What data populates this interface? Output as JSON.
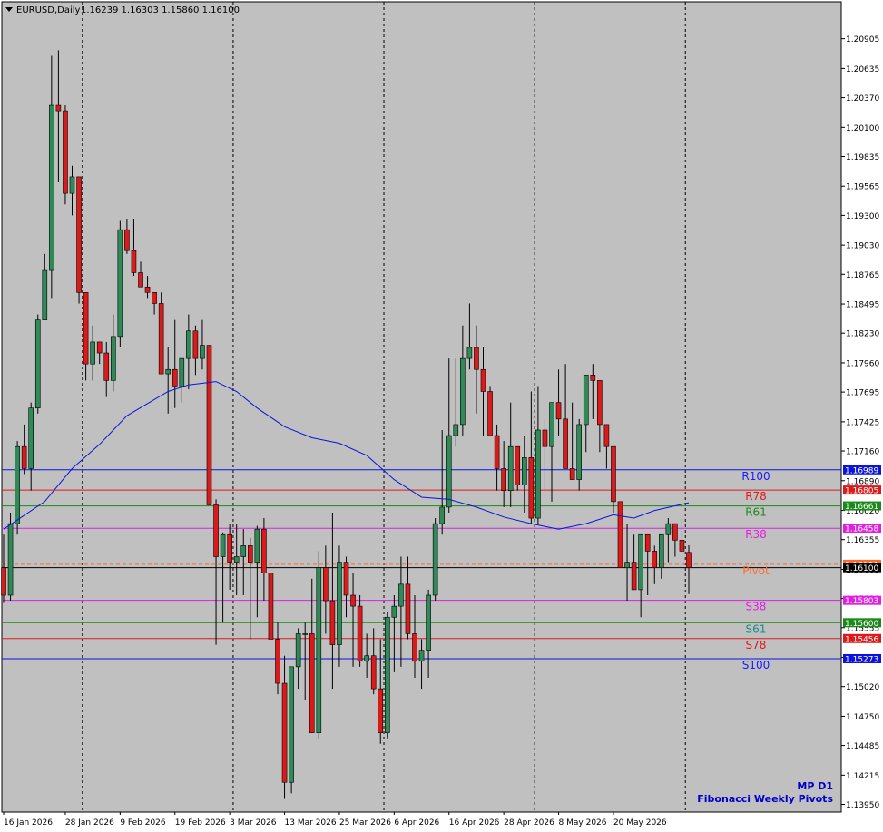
{
  "header": {
    "symbol": "EURUSD,Daily",
    "ohlc": "1.16239 1.16303 1.15860 1.16100",
    "menu_icon": "triangle-down-icon"
  },
  "branding": {
    "line1": "MP D1",
    "line2": "Fibonacci Weekly Pivots"
  },
  "colors": {
    "plot_bg": "#c0c0c0",
    "bull_body": "#2e8b57",
    "bear_body": "#dc1a1a",
    "wick": "#000000",
    "ma_line": "#0a14dc",
    "brand": "#0000cc",
    "current_price": "#ff6a2a"
  },
  "chart_data": {
    "type": "candlestick",
    "title": "EURUSD,Daily",
    "ylim": [
      1.1388,
      1.2124
    ],
    "y_ticks": [
      "1.20905",
      "1.20635",
      "1.20370",
      "1.20100",
      "1.19835",
      "1.19565",
      "1.19300",
      "1.19030",
      "1.18765",
      "1.18495",
      "1.18230",
      "1.17960",
      "1.17695",
      "1.17425",
      "1.17160",
      "1.16890",
      "1.16620",
      "1.16355",
      "1.16085",
      "1.15820",
      "1.15555",
      "1.15285",
      "1.15020",
      "1.14750",
      "1.14485",
      "1.14215",
      "1.13950"
    ],
    "x_labels": [
      {
        "label": "16 Jan 2026",
        "i": 0
      },
      {
        "label": "28 Jan 2026",
        "i": 9
      },
      {
        "label": "9 Feb 2026",
        "i": 17
      },
      {
        "label": "19 Feb 2026",
        "i": 25
      },
      {
        "label": "3 Mar 2026",
        "i": 33
      },
      {
        "label": "13 Mar 2026",
        "i": 41
      },
      {
        "label": "25 Mar 2026",
        "i": 49
      },
      {
        "label": "6 Apr 2026",
        "i": 57
      },
      {
        "label": "16 Apr 2026",
        "i": 65
      },
      {
        "label": "28 Apr 2026",
        "i": 73
      },
      {
        "label": "8 May 2026",
        "i": 81
      },
      {
        "label": "20 May 2026",
        "i": 89
      }
    ],
    "period_separators": [
      11.5,
      33.5,
      55.5,
      77.5,
      99.5
    ],
    "candles": [
      [
        1.161,
        1.164,
        1.1578,
        1.1585
      ],
      [
        1.1585,
        1.166,
        1.158,
        1.165
      ],
      [
        1.165,
        1.1725,
        1.164,
        1.172
      ],
      [
        1.172,
        1.174,
        1.1695,
        1.17
      ],
      [
        1.17,
        1.176,
        1.168,
        1.1755
      ],
      [
        1.1755,
        1.184,
        1.175,
        1.1835
      ],
      [
        1.1835,
        1.1895,
        1.187,
        1.188
      ],
      [
        1.188,
        1.2075,
        1.1855,
        1.203
      ],
      [
        1.203,
        1.208,
        1.196,
        1.2025
      ],
      [
        1.2025,
        1.203,
        1.194,
        1.195
      ],
      [
        1.195,
        1.1975,
        1.193,
        1.1965
      ],
      [
        1.1965,
        1.1965,
        1.185,
        1.186
      ],
      [
        1.186,
        1.186,
        1.178,
        1.1795
      ],
      [
        1.1795,
        1.183,
        1.178,
        1.1815
      ],
      [
        1.1815,
        1.1815,
        1.1795,
        1.1805
      ],
      [
        1.1805,
        1.1815,
        1.1765,
        1.178
      ],
      [
        1.178,
        1.184,
        1.177,
        1.182
      ],
      [
        1.182,
        1.1925,
        1.181,
        1.1917
      ],
      [
        1.1917,
        1.1927,
        1.1895,
        1.1898
      ],
      [
        1.1898,
        1.1927,
        1.1875,
        1.1878
      ],
      [
        1.1878,
        1.1888,
        1.1868,
        1.1865
      ],
      [
        1.1865,
        1.1875,
        1.1855,
        1.186
      ],
      [
        1.186,
        1.186,
        1.184,
        1.185
      ],
      [
        1.185,
        1.186,
        1.179,
        1.1786
      ],
      [
        1.1786,
        1.181,
        1.175,
        1.179
      ],
      [
        1.179,
        1.1835,
        1.1755,
        1.1775
      ],
      [
        1.1775,
        1.18,
        1.176,
        1.18
      ],
      [
        1.18,
        1.184,
        1.1772,
        1.1825
      ],
      [
        1.1825,
        1.183,
        1.1785,
        1.18
      ],
      [
        1.18,
        1.1835,
        1.179,
        1.1812
      ],
      [
        1.1812,
        1.179,
        1.17,
        1.1667
      ],
      [
        1.1667,
        1.1672,
        1.154,
        1.162
      ],
      [
        1.162,
        1.1642,
        1.156,
        1.164
      ],
      [
        1.164,
        1.165,
        1.159,
        1.1615
      ],
      [
        1.1615,
        1.165,
        1.1585,
        1.162
      ],
      [
        1.162,
        1.1645,
        1.1585,
        1.163
      ],
      [
        1.163,
        1.1637,
        1.1545,
        1.1615
      ],
      [
        1.1615,
        1.1648,
        1.1565,
        1.1645
      ],
      [
        1.1645,
        1.1655,
        1.158,
        1.1605
      ],
      [
        1.1605,
        1.1605,
        1.156,
        1.1545
      ],
      [
        1.1545,
        1.156,
        1.1495,
        1.1505
      ],
      [
        1.1505,
        1.153,
        1.14,
        1.1415
      ],
      [
        1.1415,
        1.152,
        1.1405,
        1.152
      ],
      [
        1.152,
        1.1555,
        1.15,
        1.155
      ],
      [
        1.155,
        1.156,
        1.149,
        1.155
      ],
      [
        1.155,
        1.16,
        1.1535,
        1.146
      ],
      [
        1.146,
        1.1625,
        1.1455,
        1.161
      ],
      [
        1.161,
        1.163,
        1.155,
        1.158
      ],
      [
        1.158,
        1.166,
        1.15,
        1.154
      ],
      [
        1.154,
        1.163,
        1.152,
        1.1615
      ],
      [
        1.1615,
        1.162,
        1.1565,
        1.1585
      ],
      [
        1.1585,
        1.1605,
        1.152,
        1.1575
      ],
      [
        1.1575,
        1.1585,
        1.152,
        1.1525
      ],
      [
        1.1525,
        1.155,
        1.151,
        1.153
      ],
      [
        1.153,
        1.1555,
        1.1495,
        1.15
      ],
      [
        1.15,
        1.1545,
        1.145,
        1.146
      ],
      [
        1.146,
        1.157,
        1.1455,
        1.1565
      ],
      [
        1.1565,
        1.1585,
        1.1515,
        1.1575
      ],
      [
        1.1575,
        1.162,
        1.152,
        1.1595
      ],
      [
        1.1595,
        1.162,
        1.1545,
        1.155
      ],
      [
        1.155,
        1.1585,
        1.151,
        1.1525
      ],
      [
        1.1525,
        1.1545,
        1.15,
        1.1535
      ],
      [
        1.1535,
        1.159,
        1.151,
        1.1585
      ],
      [
        1.1585,
        1.1655,
        1.158,
        1.165
      ],
      [
        1.165,
        1.1735,
        1.164,
        1.1665
      ],
      [
        1.1665,
        1.18,
        1.166,
        1.173
      ],
      [
        1.173,
        1.18,
        1.172,
        1.174
      ],
      [
        1.174,
        1.183,
        1.173,
        1.18
      ],
      [
        1.18,
        1.185,
        1.179,
        1.181
      ],
      [
        1.181,
        1.183,
        1.175,
        1.179
      ],
      [
        1.179,
        1.181,
        1.173,
        1.177
      ],
      [
        1.177,
        1.1775,
        1.173,
        1.173
      ],
      [
        1.173,
        1.174,
        1.168,
        1.17
      ],
      [
        1.17,
        1.1725,
        1.1665,
        1.168
      ],
      [
        1.168,
        1.176,
        1.1665,
        1.172
      ],
      [
        1.172,
        1.172,
        1.168,
        1.1685
      ],
      [
        1.1685,
        1.173,
        1.166,
        1.171
      ],
      [
        1.171,
        1.177,
        1.165,
        1.1655
      ],
      [
        1.1655,
        1.1775,
        1.165,
        1.1735
      ],
      [
        1.1735,
        1.1745,
        1.168,
        1.172
      ],
      [
        1.172,
        1.1745,
        1.167,
        1.176
      ],
      [
        1.176,
        1.179,
        1.173,
        1.1745
      ],
      [
        1.1745,
        1.1795,
        1.1715,
        1.17
      ],
      [
        1.17,
        1.176,
        1.169,
        1.169
      ],
      [
        1.169,
        1.1745,
        1.168,
        1.174
      ],
      [
        1.174,
        1.1775,
        1.1715,
        1.1785
      ],
      [
        1.1785,
        1.1795,
        1.1745,
        1.178
      ],
      [
        1.178,
        1.178,
        1.1715,
        1.174
      ],
      [
        1.174,
        1.174,
        1.17,
        1.172
      ],
      [
        1.172,
        1.172,
        1.166,
        1.167
      ],
      [
        1.167,
        1.167,
        1.161,
        1.161
      ],
      [
        1.161,
        1.165,
        1.158,
        1.1615
      ],
      [
        1.1615,
        1.164,
        1.161,
        1.159
      ],
      [
        1.159,
        1.164,
        1.1565,
        1.164
      ],
      [
        1.164,
        1.1635,
        1.1585,
        1.1625
      ],
      [
        1.1625,
        1.163,
        1.1595,
        1.161
      ],
      [
        1.161,
        1.164,
        1.16,
        1.164
      ],
      [
        1.164,
        1.1655,
        1.1615,
        1.165
      ],
      [
        1.165,
        1.165,
        1.162,
        1.1635
      ],
      [
        1.1635,
        1.1655,
        1.1625,
        1.1625
      ],
      [
        1.16239,
        1.16303,
        1.1586,
        1.161
      ]
    ],
    "ma_line": [
      [
        0,
        1.1645
      ],
      [
        6,
        1.167
      ],
      [
        10,
        1.17
      ],
      [
        14,
        1.1722
      ],
      [
        18,
        1.1748
      ],
      [
        24,
        1.177
      ],
      [
        27,
        1.1776
      ],
      [
        31,
        1.1779
      ],
      [
        34,
        1.177
      ],
      [
        37,
        1.1755
      ],
      [
        41,
        1.1738
      ],
      [
        45,
        1.1728
      ],
      [
        49,
        1.1723
      ],
      [
        53,
        1.1712
      ],
      [
        57,
        1.169
      ],
      [
        61,
        1.1674
      ],
      [
        65,
        1.1672
      ],
      [
        69,
        1.1665
      ],
      [
        73,
        1.1656
      ],
      [
        77,
        1.165
      ],
      [
        81,
        1.1645
      ],
      [
        85,
        1.165
      ],
      [
        89,
        1.1658
      ],
      [
        92,
        1.1655
      ],
      [
        95,
        1.1662
      ],
      [
        100,
        1.1669
      ]
    ],
    "pivots": [
      {
        "name": "R100",
        "value": 1.16989,
        "color": "#0a14dc",
        "label_color": "#1a1aff"
      },
      {
        "name": "R78",
        "value": 1.16805,
        "color": "#dc1a1a",
        "label_color": "#e01a1a"
      },
      {
        "name": "R61",
        "value": 1.16661,
        "color": "#1a8a1a",
        "label_color": "#1a8a1a"
      },
      {
        "name": "R38",
        "value": 1.16458,
        "color": "#e020e0",
        "label_color": "#e020e0"
      },
      {
        "name": "Pivot",
        "value": 1.16131,
        "color": "#ff6a2a",
        "label_color": "#ff6a2a",
        "dashed": true
      },
      {
        "name": "S38",
        "value": 1.15803,
        "color": "#e020e0",
        "label_color": "#e020e0"
      },
      {
        "name": "S61",
        "value": 1.156,
        "color": "#1a8a1a",
        "label_color": "#1a8a8a"
      },
      {
        "name": "S78",
        "value": 1.15456,
        "color": "#dc1a1a",
        "label_color": "#e01a1a"
      },
      {
        "name": "S100",
        "value": 1.15273,
        "color": "#0a14dc",
        "label_color": "#1a1aff"
      }
    ],
    "price_boxes": [
      {
        "text": "1.16989",
        "value": 1.16989,
        "bg": "#0a14dc"
      },
      {
        "text": "1.16805",
        "value": 1.16805,
        "bg": "#dc1a1a"
      },
      {
        "text": "1.16661",
        "value": 1.16661,
        "bg": "#1a8a1a"
      },
      {
        "text": "1.16458",
        "value": 1.16458,
        "bg": "#e020e0"
      },
      {
        "text": "1.16131",
        "value": 1.16131,
        "bg": "#ff6a2a"
      },
      {
        "text": "1.16100",
        "value": 1.161,
        "bg": "#000000"
      },
      {
        "text": "1.15803",
        "value": 1.15803,
        "bg": "#e020e0"
      },
      {
        "text": "1.15600",
        "value": 1.156,
        "bg": "#1a8a1a"
      },
      {
        "text": "1.15456",
        "value": 1.15456,
        "bg": "#dc1a1a"
      },
      {
        "text": "1.15273",
        "value": 1.15273,
        "bg": "#0a14dc"
      }
    ],
    "current_price": 1.161
  }
}
